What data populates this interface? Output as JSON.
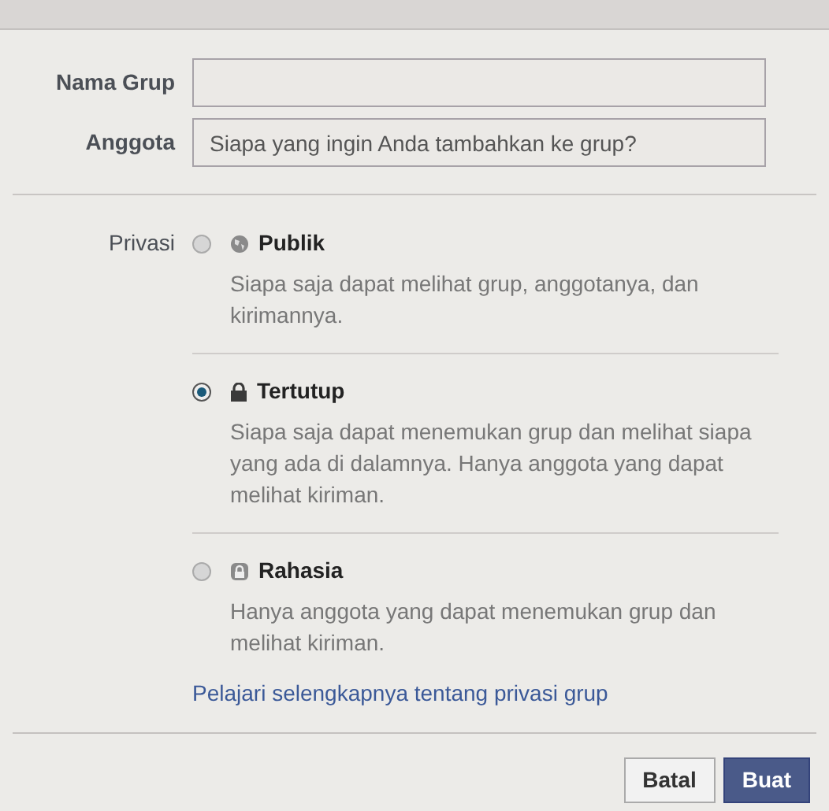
{
  "form": {
    "fields": [
      {
        "label": "Nama Grup"
      },
      {
        "label": "Anggota",
        "placeholder": "Siapa yang ingin Anda tambahkan ke grup?"
      }
    ]
  },
  "privacy": {
    "label": "Privasi",
    "options": [
      {
        "title": "Publik",
        "kind": "globe",
        "description": "Siapa saja dapat melihat grup, anggotanya, dan kirimannya.",
        "selected": false
      },
      {
        "title": "Tertutup",
        "kind": "lock",
        "description": "Siapa saja dapat menemukan grup dan melihat siapa yang ada di dalamnya. Hanya anggota yang dapat melihat kiriman.",
        "selected": true
      },
      {
        "title": "Rahasia",
        "kind": "lock-outline",
        "description": "Hanya anggota yang dapat menemukan grup dan melihat kiriman.",
        "selected": false
      }
    ],
    "link": "Pelajari selengkapnya tentang privasi grup"
  },
  "buttons": [
    {
      "label": "Batal",
      "kind": "secondary"
    },
    {
      "label": "Buat",
      "kind": "primary"
    }
  ]
}
